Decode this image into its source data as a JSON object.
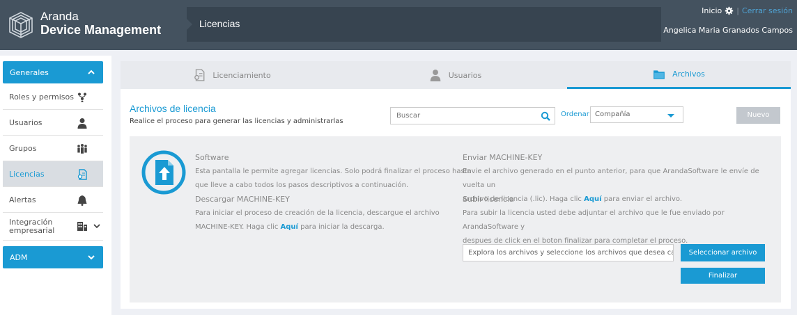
{
  "header": {
    "brand_line1": "Aranda",
    "brand_line2": "Device Management",
    "breadcrumb": "Licencias",
    "home_link": "Inicio",
    "separator": "|",
    "logout_link": "Cerrar sesión",
    "user_name": "Angelica Maria Granados Campos"
  },
  "sidebar": {
    "group1_label": "Generales",
    "items": [
      {
        "label": "Roles y permisos",
        "icon": "roles-icon"
      },
      {
        "label": "Usuarios",
        "icon": "user-icon"
      },
      {
        "label": "Grupos",
        "icon": "group-icon"
      },
      {
        "label": "Licencias",
        "icon": "license-icon"
      },
      {
        "label": "Alertas",
        "icon": "bell-icon"
      },
      {
        "label": "Integración empresarial",
        "icon": "building-icon"
      }
    ],
    "group2_label": "ADM"
  },
  "tabs": [
    {
      "label": "Licenciamiento",
      "icon": "license-doc-icon"
    },
    {
      "label": "Usuarios",
      "icon": "user-icon"
    },
    {
      "label": "Archivos",
      "icon": "folder-icon"
    }
  ],
  "content": {
    "title": "Archivos de licencia",
    "subtitle": "Realice el proceso para generar las licencias y administrarlas",
    "search_placeholder": "Buscar",
    "order_label": "Ordenar:",
    "order_value": "Compañía",
    "new_button": "Nuevo"
  },
  "panel": {
    "software_title": "Software",
    "software_text_1": "Esta pantalla le permite agregar licencias. Solo podrá finalizar el proceso hasta",
    "software_text_2": "que lleve a cabo todos los pasos descriptivos a continuación.",
    "download_title": "Descargar MACHINE-KEY",
    "download_text_1": "Para iniciar el proceso de creación de la licencia, descargue el archivo",
    "download_text_2a": "MACHINE-KEY. Haga clic ",
    "download_link": "Aquí",
    "download_text_2b": " para iniciar la descarga.",
    "send_title": "Enviar MACHINE-KEY",
    "send_text_1": "Envie el archivo generado en el punto anterior, para que ArandaSoftware le envíe de vuelta un",
    "send_text_2a": "archivo de licencia (.lic). Haga clic ",
    "send_link": "Aquí",
    "send_text_2b": " para enviar el archivo.",
    "upload_title": "Subir licencia",
    "upload_text_1": "Para subir la licencia usted debe adjuntar el archivo que le fue enviado por ArandaSoftware y",
    "upload_text_2": "despues de click en el boton finalizar para completar el proceso.",
    "file_placeholder": "Explora los archivos y seleccione los archivos que desea cargar",
    "select_button": "Seleccionar archivo",
    "finish_button": "Finalizar"
  },
  "colors": {
    "accent": "#1a9ad3",
    "header_bg": "#44525f",
    "crumb_bg": "#374450"
  }
}
